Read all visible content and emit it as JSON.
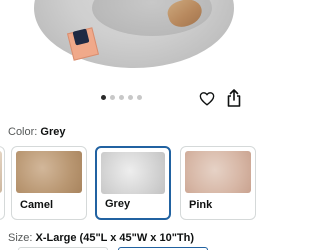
{
  "product_image": {
    "carousel_total": 5,
    "carousel_active_index": 0
  },
  "actions": {
    "favorite_icon": "heart-icon",
    "share_icon": "share-icon"
  },
  "color": {
    "label": "Color:",
    "selected": "Grey",
    "options": [
      {
        "name": "Camel"
      },
      {
        "name": "Grey"
      },
      {
        "name": "Pink"
      }
    ]
  },
  "size": {
    "label": "Size:",
    "selected": "X-Large (45\"L x 45\"W x 10\"Th)"
  },
  "colors": {
    "selected_border": "#2162a1",
    "swatch_border": "#d5d9d9",
    "label_gray": "#565959"
  }
}
